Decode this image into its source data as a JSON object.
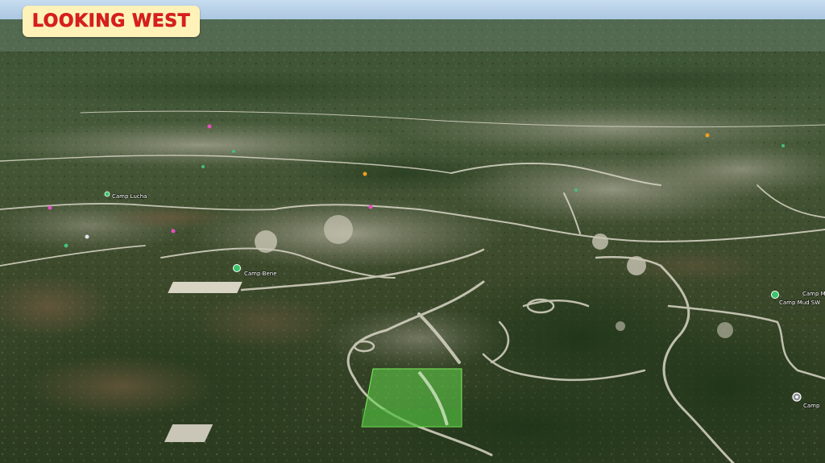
{
  "overlay": {
    "title": "LOOKING WEST",
    "title_color": "#d81e1e",
    "background_color": "#fff2b8"
  },
  "colors": {
    "sky": "#b9d3e8",
    "vegetation": "#2f4a25",
    "clearing": "#b8b7a4",
    "highlight_parcel": "#5cd14a"
  },
  "map_markers": [
    {
      "label": "Camp Mud",
      "icon": "green-poi-pin-icon"
    },
    {
      "label": "Camp Mud  SW",
      "icon": "green-poi-pin-icon"
    },
    {
      "label": "Camp Bene",
      "icon": "green-poi-pin-icon"
    },
    {
      "label": "Camp Lucha",
      "icon": "green-poi-pin-icon"
    },
    {
      "label": "Camp",
      "icon": "location-pin-icon"
    }
  ]
}
